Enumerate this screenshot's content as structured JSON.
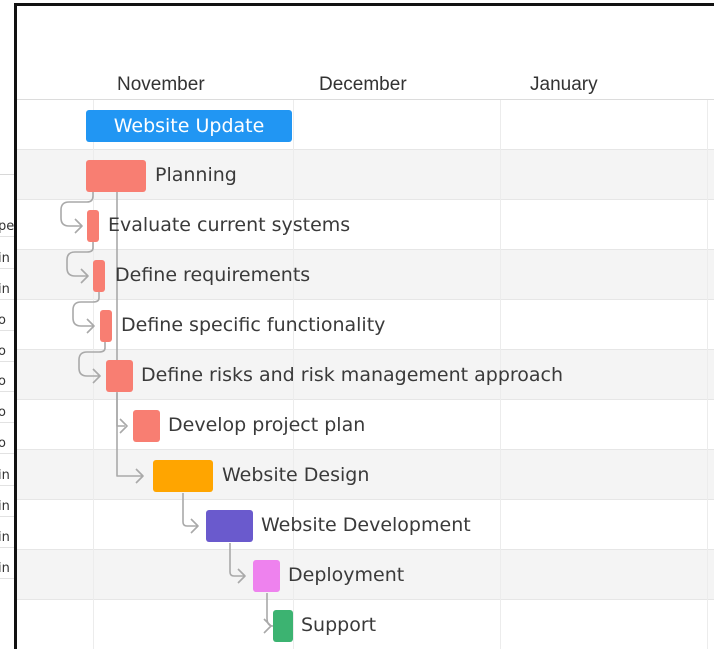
{
  "months": [
    "November",
    "December",
    "January"
  ],
  "project": {
    "name": "Website Update",
    "color": "#2196f3"
  },
  "tasks": [
    {
      "name": "Planning",
      "color": "#f87e72"
    },
    {
      "name": "Evaluate current systems",
      "color": "#f87e72"
    },
    {
      "name": "Define requirements",
      "color": "#f87e72"
    },
    {
      "name": "Define specific functionality",
      "color": "#f87e72"
    },
    {
      "name": "Define risks and risk management approach",
      "color": "#f87e72"
    },
    {
      "name": "Develop project plan",
      "color": "#f87e72"
    },
    {
      "name": "Website Design",
      "color": "#ffa500"
    },
    {
      "name": "Website Development",
      "color": "#6a5acd"
    },
    {
      "name": "Deployment",
      "color": "#ee82ee"
    },
    {
      "name": "Support",
      "color": "#3cb371"
    }
  ],
  "left_panel": {
    "cells": [
      "pe",
      "in",
      "in",
      "o",
      "o",
      "o",
      "o",
      "o",
      "in",
      "in",
      "in",
      "in"
    ]
  }
}
